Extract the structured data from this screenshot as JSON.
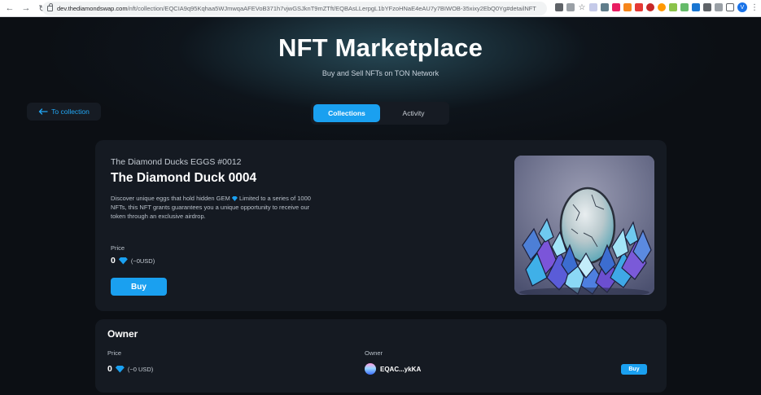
{
  "browser": {
    "url_host": "dev.thediamondswap.com",
    "url_path": "/nft/collection/EQCIA9q95Kqhaa5WJmwqaAFEVoB371h7vjwGSJknT9mZTft/EQBAsLLerpgL1bYFzoHNaE4eAU7y7BIWOB-35xixy2EbQ0Yg#detailNFT",
    "profile_initial": "V"
  },
  "hero": {
    "title": "NFT Marketplace",
    "subtitle": "Buy and Sell NFTs on TON Network"
  },
  "back_button": {
    "label": "To collection"
  },
  "tabs": [
    {
      "label": "Collections",
      "active": true
    },
    {
      "label": "Activity",
      "active": false
    }
  ],
  "nft": {
    "collection": "The Diamond Ducks EGGS #0012",
    "name": "The Diamond Duck 0004",
    "description_part1": "Discover unique eggs that hold hidden GEM",
    "description_part2": " Limited to a series of 1000 NFTs, this NFT grants guarantees you a unique opportunity to receive our token through an exclusive airdrop.",
    "price_label": "Price",
    "price_value": "0",
    "price_usd": "(~0USD)",
    "buy_label": "Buy"
  },
  "owner_section": {
    "title": "Owner",
    "price_label": "Price",
    "price_value": "0",
    "price_usd": "(~0 USD)",
    "owner_label": "Owner",
    "owner_address": "EQAC...ykKA",
    "buy_label": "Buy"
  },
  "colors": {
    "accent": "#1aa0f0",
    "background": "#0c0f14",
    "card": "#151a22"
  }
}
